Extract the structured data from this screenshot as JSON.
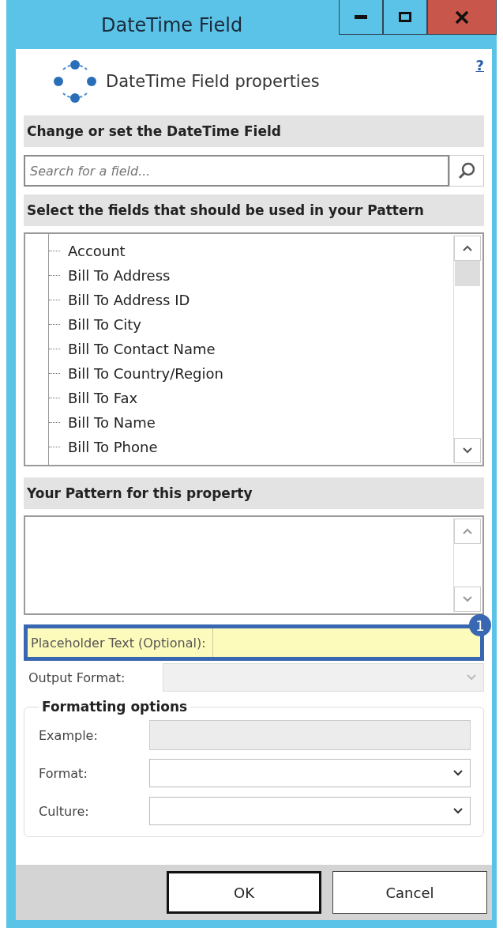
{
  "window": {
    "title": "DateTime Field"
  },
  "header": {
    "title": "DateTime Field properties",
    "help": "?"
  },
  "field_section": {
    "heading": "Change or set the DateTime Field",
    "search": {
      "placeholder": "Search for a field..."
    }
  },
  "fields_section": {
    "heading": "Select the fields that should be used in your Pattern",
    "items": [
      {
        "label": "Account"
      },
      {
        "label": "Bill To Address"
      },
      {
        "label": "Bill To Address ID"
      },
      {
        "label": "Bill To City"
      },
      {
        "label": "Bill To Contact Name"
      },
      {
        "label": "Bill To Country/Region"
      },
      {
        "label": "Bill To Fax"
      },
      {
        "label": "Bill To Name"
      },
      {
        "label": "Bill To Phone"
      }
    ]
  },
  "pattern_section": {
    "heading": "Your Pattern for this property"
  },
  "placeholder_row": {
    "label": "Placeholder Text (Optional):",
    "highlighted": true,
    "badge": "1"
  },
  "output_format": {
    "label": "Output Format:",
    "disabled": true
  },
  "formatting_options": {
    "title": "Formatting options",
    "rows": [
      {
        "label": "Example:",
        "kind": "text",
        "disabled": true
      },
      {
        "label": "Format:",
        "kind": "dropdown",
        "disabled": false
      },
      {
        "label": "Culture:",
        "kind": "dropdown",
        "disabled": false
      }
    ]
  },
  "buttons": [
    {
      "label": "OK",
      "default": true
    },
    {
      "label": "Cancel",
      "default": false
    }
  ]
}
